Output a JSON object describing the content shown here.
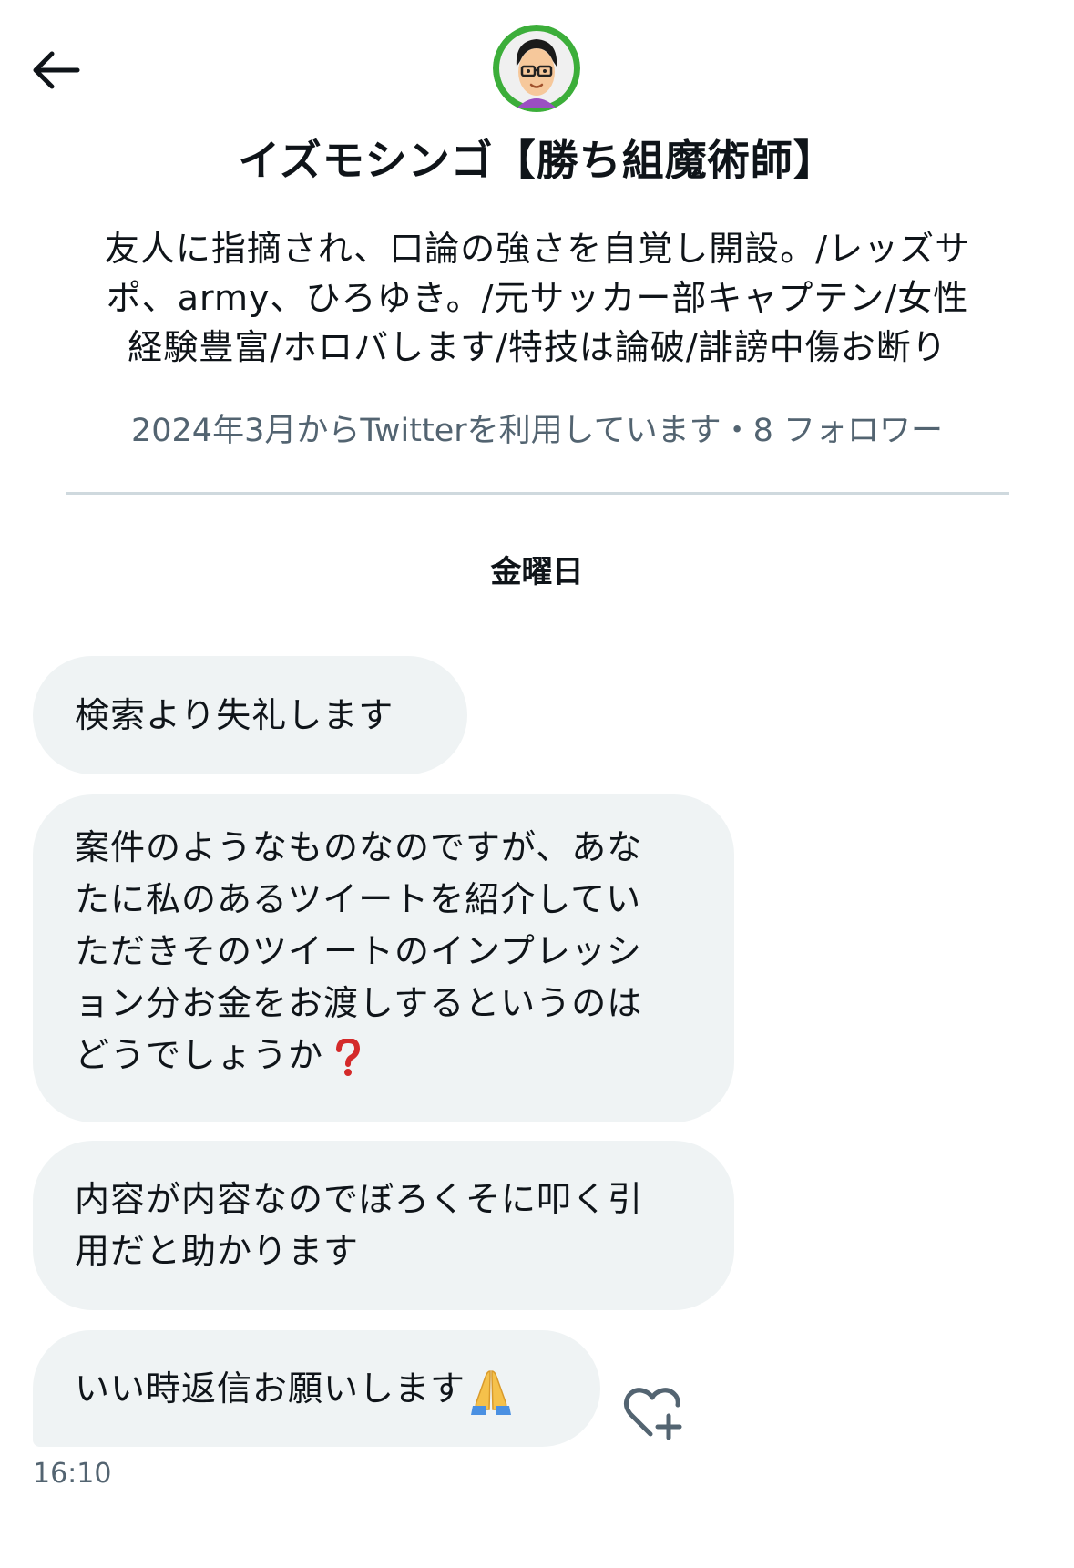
{
  "header": {
    "display_name": "イズモシンゴ【勝ち組魔術師】",
    "bio_lines": [
      "友人に指摘され、口論の強さを自覚し開設。/レッズサ",
      "ポ、army、ひろゆき。/元サッカー部キャプテン/女性",
      "経験豊富/ホロバします/特技は論破/誹謗中傷お断り"
    ],
    "joined_text": "2024年3月からTwitterを利用しています・8 フォロワー"
  },
  "conversation": {
    "day_label": "金曜日",
    "messages": [
      {
        "lines": [
          "検索より失礼します"
        ]
      },
      {
        "lines": [
          "案件のようなものなのですが、あな",
          "たに私のあるツイートを紹介してい",
          "ただきそのツイートのインプレッシ",
          "ョン分お金をお渡しするというのは",
          "どうでしょうか"
        ],
        "trailing_emoji": "red-question-mark-icon"
      },
      {
        "lines": [
          "内容が内容なのでぼろくそに叩く引",
          "用だと助かります"
        ]
      },
      {
        "lines": [
          "いい時返信お願いします"
        ],
        "trailing_emoji": "folded-hands-icon"
      }
    ],
    "timestamp": "16:10"
  },
  "icons": {
    "back": "arrow-left-icon",
    "react": "heart-plus-icon"
  },
  "colors": {
    "bubble_bg": "#eff3f4",
    "secondary_text": "#536471",
    "avatar_ring": "#3cae3a"
  }
}
